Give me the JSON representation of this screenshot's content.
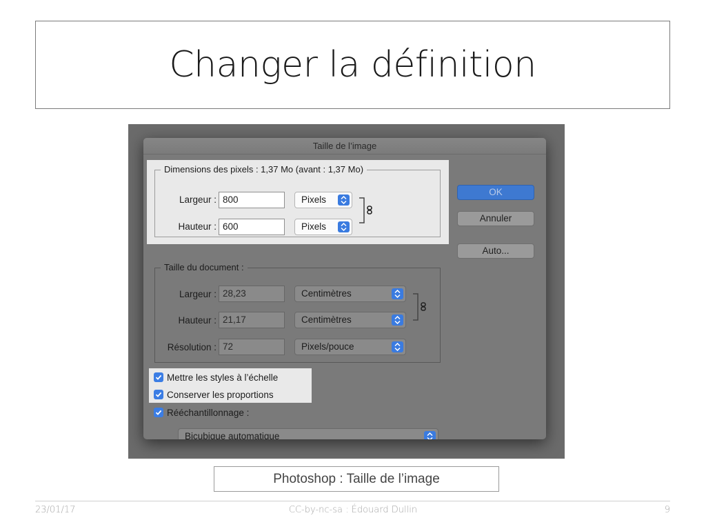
{
  "slide": {
    "title": "Changer la définition",
    "caption": "Photoshop : Taille de l’image",
    "footer_date": "23/01/17",
    "footer_center": "CC-by-nc-sa : Édouard Dullin",
    "footer_page": "9"
  },
  "dialog": {
    "title": "Taille de l’image",
    "pixel_dimensions": {
      "title": "Dimensions des pixels : 1,37 Mo (avant : 1,37 Mo)",
      "width_label": "Largeur :",
      "width_value": "800",
      "width_unit": "Pixels",
      "height_label": "Hauteur :",
      "height_value": "600",
      "height_unit": "Pixels"
    },
    "document_size": {
      "title": "Taille du document :",
      "width_label": "Largeur :",
      "width_value": "28,23",
      "width_unit": "Centimètres",
      "height_label": "Hauteur :",
      "height_value": "21,17",
      "height_unit": "Centimètres",
      "resolution_label": "Résolution :",
      "resolution_value": "72",
      "resolution_unit": "Pixels/pouce"
    },
    "options": {
      "scale_styles": "Mettre les styles à l’échelle",
      "constrain": "Conserver les proportions",
      "resample": "Rééchantillonnage :",
      "resample_method": "Bicubique automatique"
    },
    "buttons": {
      "ok": "OK",
      "cancel": "Annuler",
      "auto": "Auto..."
    }
  },
  "colors": {
    "accent": "#3b7de4",
    "highlight": "#e9e9e9",
    "dialog_bg": "#7a7a7a"
  }
}
